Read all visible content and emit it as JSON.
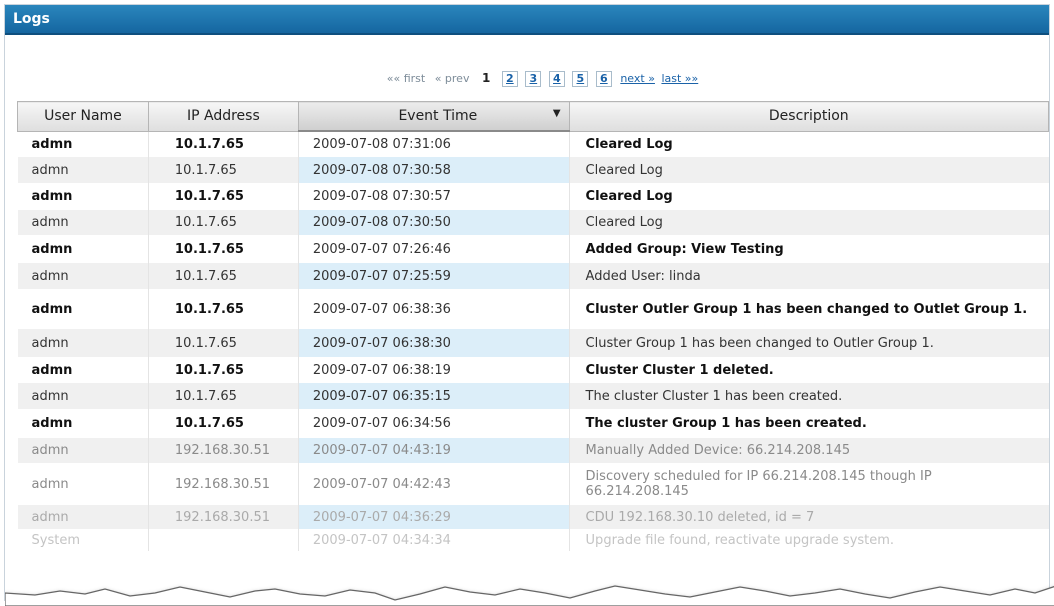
{
  "panel": {
    "title": "Logs"
  },
  "pager": {
    "first": "«« first",
    "prev": "« prev",
    "current": "1",
    "pages": [
      "2",
      "3",
      "4",
      "5",
      "6"
    ],
    "next": "next »",
    "last": "last »»"
  },
  "table": {
    "columns": [
      "User Name",
      "IP Address",
      "Event Time",
      "Description"
    ],
    "sorted_column": "Event Time",
    "rows": [
      {
        "user": "admn",
        "ip": "10.1.7.65",
        "time": "2009-07-08 07:31:06",
        "desc": "Cleared Log"
      },
      {
        "user": "admn",
        "ip": "10.1.7.65",
        "time": "2009-07-08 07:30:58",
        "desc": "Cleared Log"
      },
      {
        "user": "admn",
        "ip": "10.1.7.65",
        "time": "2009-07-08 07:30:57",
        "desc": "Cleared Log"
      },
      {
        "user": "admn",
        "ip": "10.1.7.65",
        "time": "2009-07-08 07:30:50",
        "desc": "Cleared Log"
      },
      {
        "user": "admn",
        "ip": "10.1.7.65",
        "time": "2009-07-07 07:26:46",
        "desc": "Added Group: View Testing"
      },
      {
        "user": "admn",
        "ip": "10.1.7.65",
        "time": "2009-07-07 07:25:59",
        "desc": "Added User: linda"
      },
      {
        "user": "admn",
        "ip": "10.1.7.65",
        "time": "2009-07-07 06:38:36",
        "desc": "Cluster Outler Group 1 has been changed to Outlet Group 1."
      },
      {
        "user": "admn",
        "ip": "10.1.7.65",
        "time": "2009-07-07 06:38:30",
        "desc": "Cluster Group 1 has been changed to Outler Group 1."
      },
      {
        "user": "admn",
        "ip": "10.1.7.65",
        "time": "2009-07-07 06:38:19",
        "desc": "Cluster Cluster 1 deleted."
      },
      {
        "user": "admn",
        "ip": "10.1.7.65",
        "time": "2009-07-07 06:35:15",
        "desc": "The cluster Cluster 1 has been created."
      },
      {
        "user": "admn",
        "ip": "10.1.7.65",
        "time": "2009-07-07 06:34:56",
        "desc": "The cluster Group 1 has been created."
      },
      {
        "user": "admn",
        "ip": "192.168.30.51",
        "time": "2009-07-07 04:43:19",
        "desc": "Manually Added Device: 66.214.208.145"
      },
      {
        "user": "admn",
        "ip": "192.168.30.51",
        "time": "2009-07-07 04:42:43",
        "desc": "Discovery scheduled for IP 66.214.208.145 though IP 66.214.208.145"
      },
      {
        "user": "admn",
        "ip": "192.168.30.51",
        "time": "2009-07-07 04:36:29",
        "desc": "CDU 192.168.30.10 deleted, id = 7"
      },
      {
        "user": "System",
        "ip": "",
        "time": "2009-07-07 04:34:34",
        "desc": "Upgrade file found, reactivate upgrade system."
      }
    ]
  },
  "colors": {
    "header_blue": "#1a6fa8",
    "link_blue": "#1a62a8",
    "row_alt": "#f0f0f0",
    "time_highlight": "#dceef9"
  }
}
